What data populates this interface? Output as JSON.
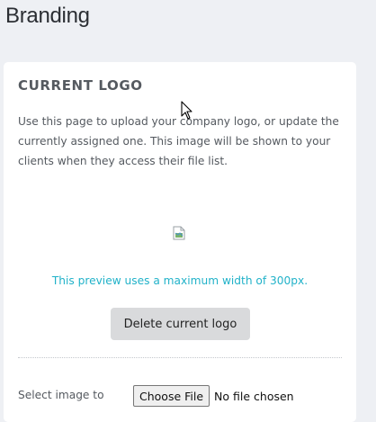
{
  "page": {
    "title": "Branding"
  },
  "current_logo": {
    "heading": "CURRENT LOGO",
    "description": "Use this page to upload your company logo, or update the currently assigned one. This image will be shown to your clients when they access their file list.",
    "image_icon": "broken-image-icon",
    "preview_note": "This preview uses a maximum width of 300px.",
    "delete_label": "Delete current logo"
  },
  "upload": {
    "select_label": "Select image to",
    "choose_file_label": "Choose File",
    "file_status": "No file chosen"
  },
  "colors": {
    "accent": "#21b2c9",
    "background": "#eef0f4",
    "card": "#ffffff",
    "button": "#d9dadc"
  }
}
